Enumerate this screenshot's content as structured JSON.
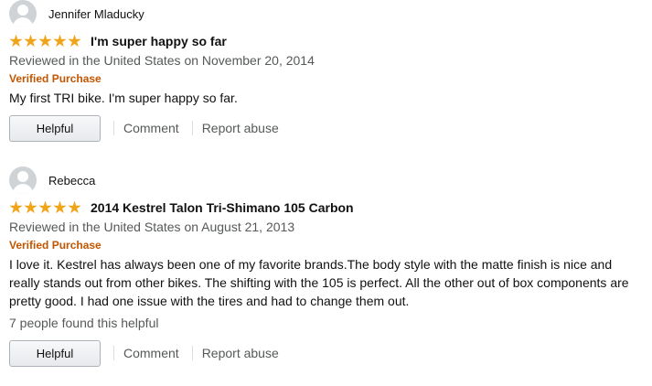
{
  "reviews": [
    {
      "reviewer": "Jennifer Mladucky",
      "rating": 5,
      "title": "I'm super happy so far",
      "meta": "Reviewed in the United States on November 20, 2014",
      "verified": "Verified Purchase",
      "body": "My first TRI bike. I'm super happy so far.",
      "helpful_count": "",
      "helpful_label": "Helpful",
      "comment_label": "Comment",
      "report_label": "Report abuse"
    },
    {
      "reviewer": "Rebecca",
      "rating": 5,
      "title": "2014 Kestrel Talon Tri-Shimano 105 Carbon",
      "meta": "Reviewed in the United States on August 21, 2013",
      "verified": "Verified Purchase",
      "body": "I love it. Kestrel has always been one of my favorite brands.The body style with the matte finish is nice and really stands out from other bikes. The shifting with the 105 is perfect. All the other out of box components are pretty good. I had one issue with the tires and had to change them out.",
      "helpful_count": "7 people found this helpful",
      "helpful_label": "Helpful",
      "comment_label": "Comment",
      "report_label": "Report abuse"
    }
  ],
  "colors": {
    "star": "#f0a41a",
    "verified": "#c45500",
    "muted": "#565959"
  }
}
